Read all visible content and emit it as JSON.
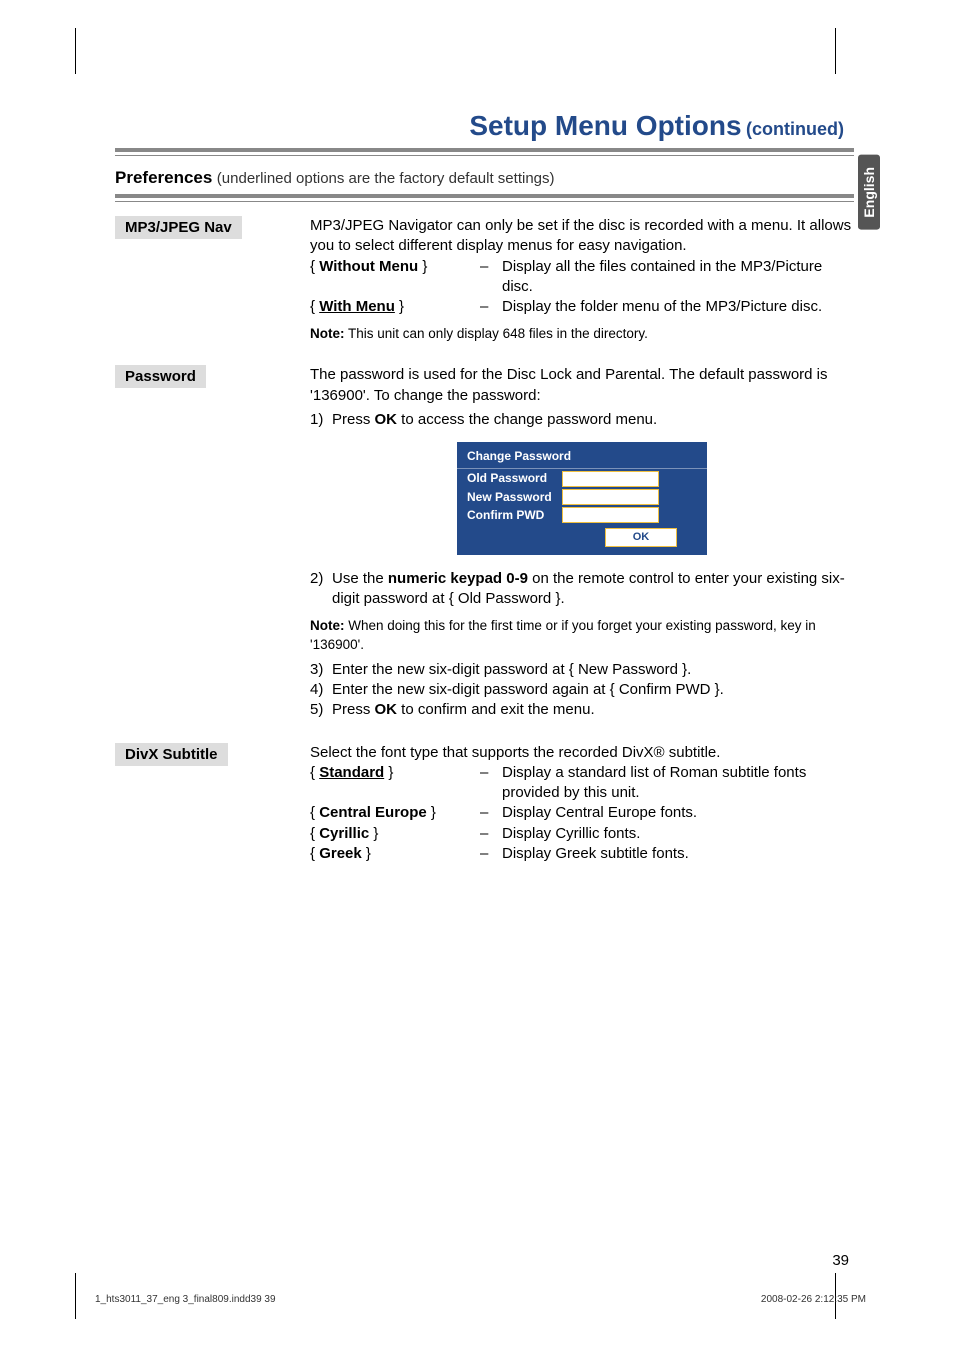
{
  "header": {
    "title": "Setup Menu Options",
    "continued": "(continued)"
  },
  "langTab": "English",
  "preferences": {
    "heading": "Preferences",
    "sub": "(underlined options are the factory default settings)"
  },
  "mp3": {
    "label": "MP3/JPEG Nav",
    "intro": "MP3/JPEG Navigator can only be set if the disc is recorded with a menu. It allows you to select different display menus for easy navigation.",
    "opts": [
      {
        "brace_open": "{ ",
        "key": "Without Menu",
        "brace_close": " }",
        "dash": "–",
        "desc": "Display all the files contained in the MP3/Picture disc.",
        "underline": false
      },
      {
        "brace_open": "{ ",
        "key": "With Menu",
        "brace_close": " }",
        "dash": "–",
        "desc": "Display the folder menu of the MP3/Picture disc.",
        "underline": true
      }
    ],
    "note_prefix": "Note:",
    "note": "This unit can only display 648 files in the directory."
  },
  "password": {
    "label": "Password",
    "intro": "The password is used for the Disc Lock and Parental. The default password is '136900'. To change the password:",
    "step1_num": "1)",
    "step1_a": "Press ",
    "step1_bold": "OK",
    "step1_b": " to access the change password menu.",
    "dialog": {
      "title": "Change Password",
      "rows": [
        "Old Password",
        "New Password",
        "Confirm PWD"
      ],
      "ok": "OK"
    },
    "step2_num": "2)",
    "step2_a": "Use the ",
    "step2_bold": "numeric keypad 0-9",
    "step2_b": " on the remote control to enter your existing six-digit password at { Old Password }.",
    "note_prefix": "Note:",
    "note": "When doing this for the first time or if you forget your existing password, key in '136900'.",
    "step3_num": "3)",
    "step3": "Enter the new six-digit password at { New Password }.",
    "step4_num": "4)",
    "step4": "Enter the new six-digit password again at { Confirm PWD }.",
    "step5_num": "5)",
    "step5_a": "Press ",
    "step5_bold": "OK",
    "step5_b": " to confirm and exit the menu."
  },
  "divx": {
    "label": "DivX Subtitle",
    "intro": "Select the font type that supports the recorded DivX® subtitle.",
    "opts": [
      {
        "brace_open": "{ ",
        "key": "Standard",
        "brace_close": " }",
        "dash": "–",
        "desc": "Display a standard list of Roman subtitle fonts provided by this unit.",
        "underline": true
      },
      {
        "brace_open": "{ ",
        "key": "Central Europe",
        "brace_close": " }",
        "dash": "–",
        "desc": "Display Central Europe fonts.",
        "underline": false
      },
      {
        "brace_open": "{ ",
        "key": "Cyrillic",
        "brace_close": " }",
        "dash": "–",
        "desc": "Display Cyrillic fonts.",
        "underline": false
      },
      {
        "brace_open": "{ ",
        "key": "Greek",
        "brace_close": " }",
        "dash": "–",
        "desc": "Display Greek subtitle fonts.",
        "underline": false
      }
    ]
  },
  "footer": {
    "pageNum": "39",
    "left": "1_hts3011_37_eng 3_final809.indd39   39",
    "right": "2008-02-26   2:12:35 PM"
  }
}
